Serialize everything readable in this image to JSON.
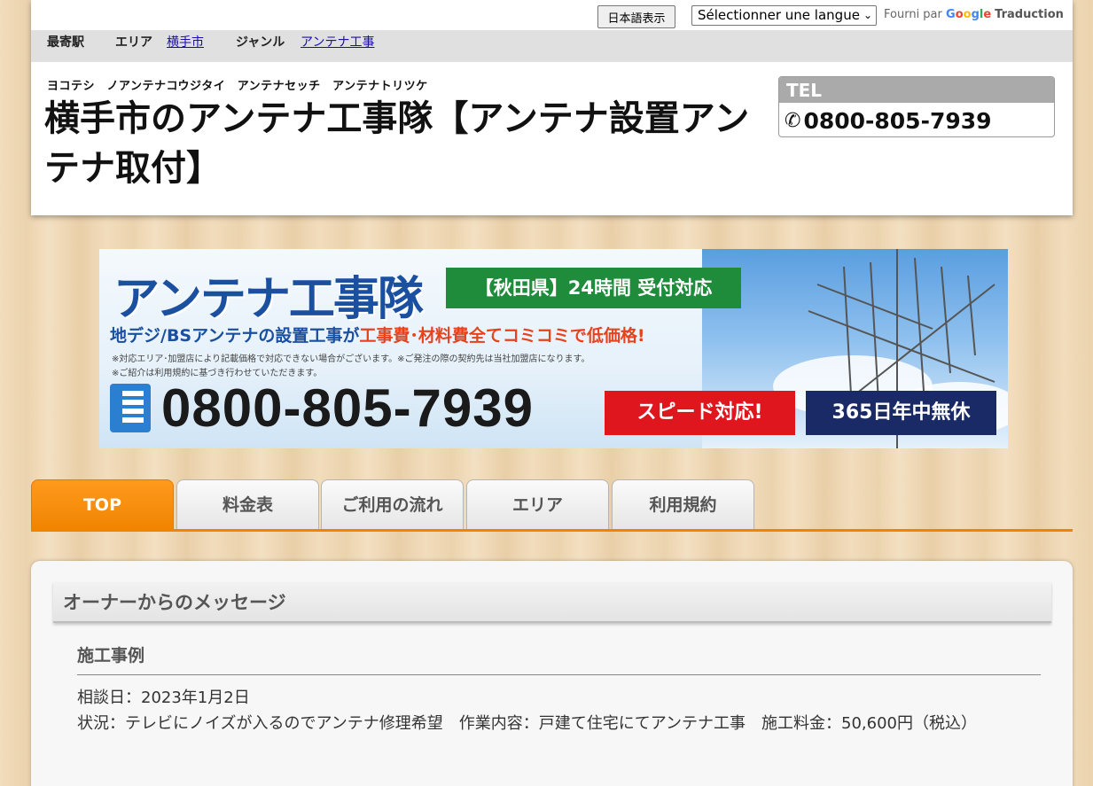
{
  "topbar": {
    "lang_button": "日本語表示",
    "lang_select": "Sélectionner une langue",
    "powered_prefix": "Fourni par",
    "google": [
      "G",
      "o",
      "o",
      "g",
      "l",
      "e"
    ],
    "translate": "Traduction"
  },
  "infobar": {
    "station_label": "最寄駅",
    "area_label": "エリア",
    "area_value": "横手市",
    "genre_label": "ジャンル",
    "genre_value": "アンテナ工事"
  },
  "header": {
    "kana": "ヨコテシ　ノアンテナコウジタイ　アンテナセッチ　アンテナトリツケ",
    "title": "横手市のアンテナ工事隊【アンテナ設置アンテナ取付】",
    "tel_label": "TEL",
    "tel_number": "0800-805-7939"
  },
  "banner": {
    "logo": "アンテナ工事隊",
    "green_badge": "【秋田県】24時間 受付対応",
    "sub_prefix": "地デジ/BSアンテナの設置工事が",
    "sub_highlight": "工事費･材料費全てコミコミで低価格!",
    "note1": "※対応エリア･加盟店により記載価格で対応できない場合がございます。※ご発注の際の契約先は当社加盟店になります。",
    "note2": "※ご紹介は利用規約に基づき行わせていただきます。",
    "phone": "0800-805-7939",
    "red_badge": "スピード対応!",
    "navy_badge": "365日年中無休"
  },
  "tabs": [
    {
      "label": "TOP",
      "active": true
    },
    {
      "label": "料金表",
      "active": false
    },
    {
      "label": "ご利用の流れ",
      "active": false
    },
    {
      "label": "エリア",
      "active": false
    },
    {
      "label": "利用規約",
      "active": false
    }
  ],
  "content": {
    "message_heading": "オーナーからのメッセージ",
    "case_title": "施工事例",
    "consult_date": "相談日：2023年1月2日",
    "situation": "状況：テレビにノイズが入るのでアンテナ修理希望　作業内容：戸建て住宅にてアンテナ工事　施工料金：50,600円（税込）"
  },
  "colors": {
    "accent_orange": "#f08400",
    "banner_blue": "#1b4fa0",
    "badge_green": "#1e8c3a",
    "badge_red": "#e0161f",
    "badge_navy": "#1a2a66"
  }
}
